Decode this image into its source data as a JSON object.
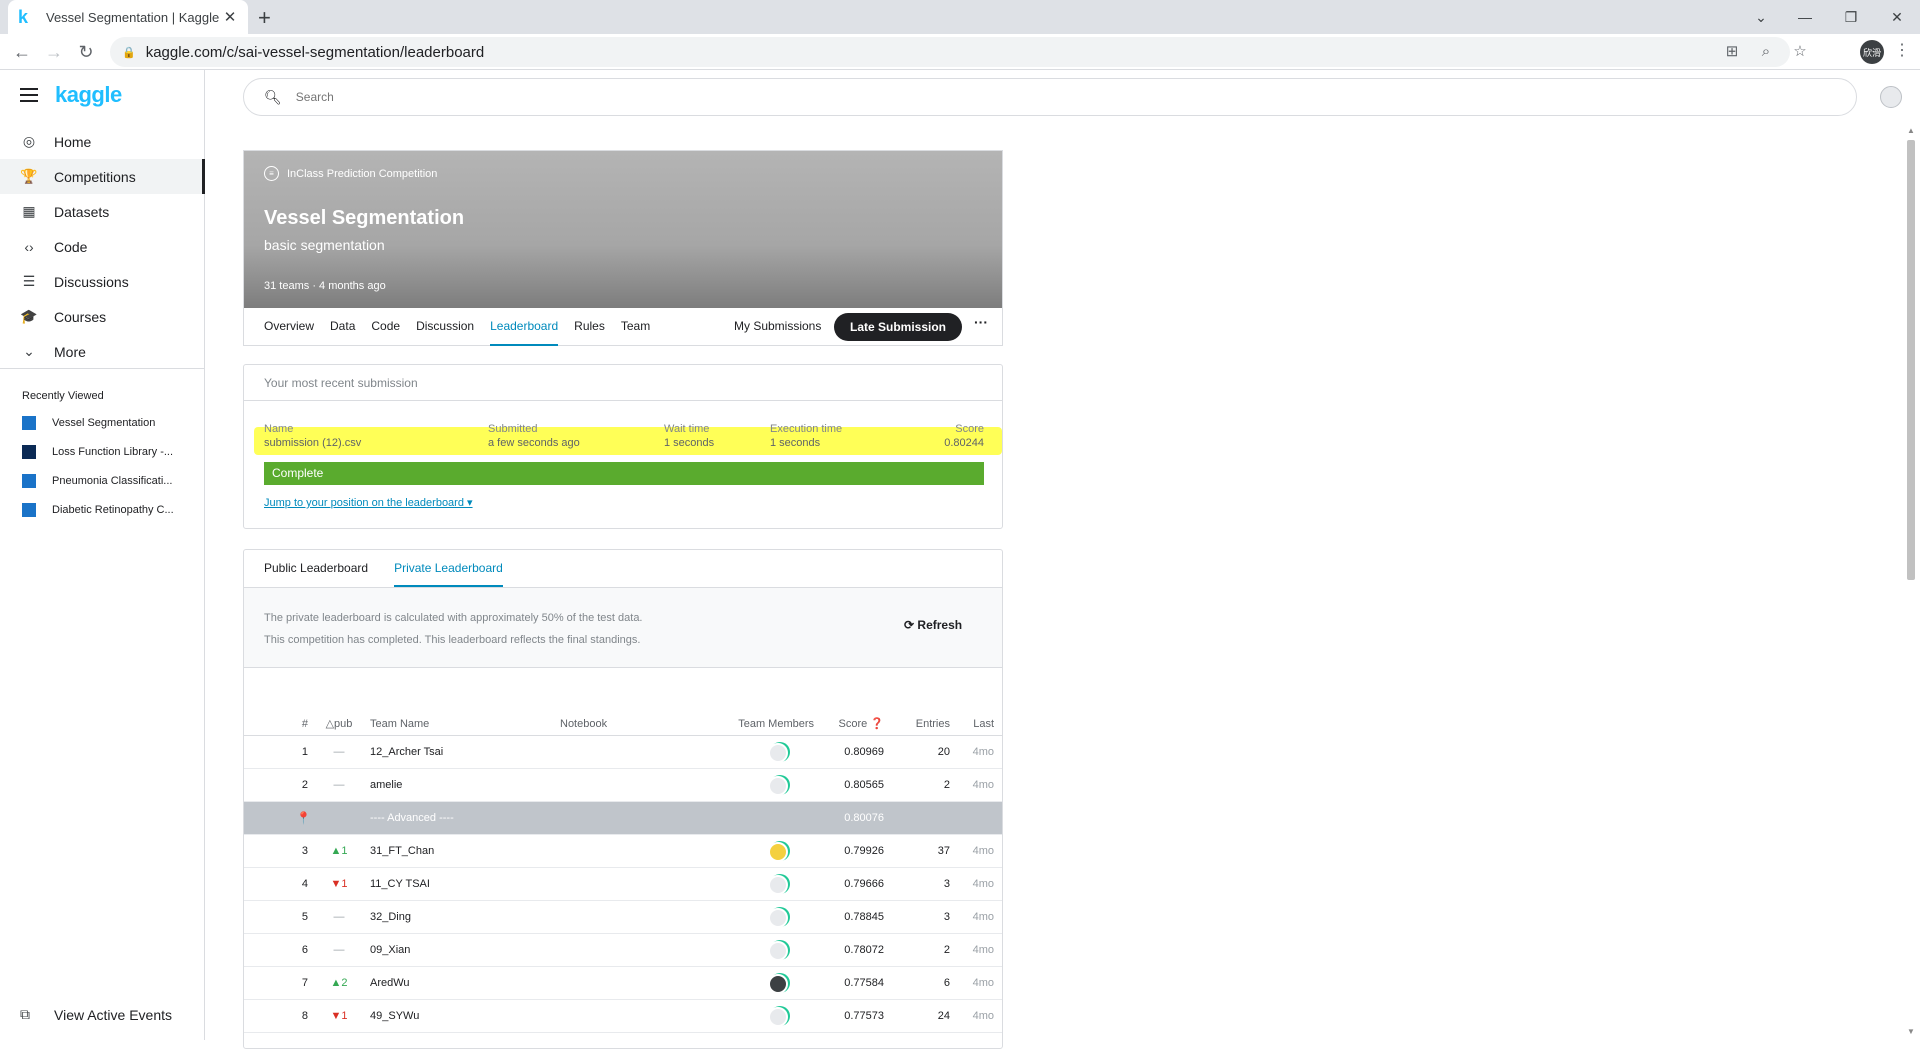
{
  "browser": {
    "tab_title": "Vessel Segmentation | Kaggle",
    "tab_favicon": "k",
    "url": "kaggle.com/c/sai-vessel-segmentation/leaderboard",
    "profile_initials": "欣滑"
  },
  "sidebar": {
    "logo": "kaggle",
    "items": [
      {
        "label": "Home",
        "icon": "compass-icon"
      },
      {
        "label": "Competitions",
        "icon": "trophy-icon"
      },
      {
        "label": "Datasets",
        "icon": "table-icon"
      },
      {
        "label": "Code",
        "icon": "code-icon"
      },
      {
        "label": "Discussions",
        "icon": "comments-icon"
      },
      {
        "label": "Courses",
        "icon": "school-icon"
      },
      {
        "label": "More",
        "icon": "chevron-down-icon"
      }
    ],
    "recently_viewed_title": "Recently Viewed",
    "recently_viewed": [
      {
        "label": "Vessel Segmentation"
      },
      {
        "label": "Loss Function Library -..."
      },
      {
        "label": "Pneumonia Classificati..."
      },
      {
        "label": "Diabetic Retinopathy C..."
      }
    ],
    "view_events": "View Active Events"
  },
  "search": {
    "placeholder": "Search"
  },
  "competition": {
    "type": "InClass Prediction Competition",
    "title": "Vessel Segmentation",
    "subtitle": "basic segmentation",
    "teams": "31 teams",
    "dot": "·",
    "age": "4 months ago",
    "tabs": [
      "Overview",
      "Data",
      "Code",
      "Discussion",
      "Leaderboard",
      "Rules",
      "Team"
    ],
    "my_submissions": "My Submissions",
    "late_submission": "Late Submission",
    "more": "···"
  },
  "submission": {
    "header": "Your most recent submission",
    "col_name": "Name",
    "col_submitted": "Submitted",
    "col_wait": "Wait time",
    "col_exec": "Execution time",
    "col_score": "Score",
    "name": "submission (12).csv",
    "submitted": "a few seconds ago",
    "wait": "1 seconds",
    "exec": "1 seconds",
    "score": "0.80244",
    "status": "Complete",
    "jump": "Jump to your position on the leaderboard ▾",
    "highlight_color": "#ffff3a"
  },
  "leaderboard": {
    "tabs": [
      "Public Leaderboard",
      "Private Leaderboard"
    ],
    "info1": "The private leaderboard is calculated with approximately 50% of the test data.",
    "info2": "This competition has completed. This leaderboard reflects the final standings.",
    "refresh": "Refresh",
    "headers": {
      "rank": "#",
      "delta": "△pub",
      "team": "Team Name",
      "notebook": "Notebook",
      "members": "Team Members",
      "score": "Score ❓",
      "entries": "Entries",
      "last": "Last"
    },
    "rows": [
      {
        "rank": "1",
        "delta": "—",
        "team": "12_Archer Tsai",
        "score": "0.80969",
        "entries": "20",
        "last": "4mo"
      },
      {
        "rank": "2",
        "delta": "—",
        "team": "amelie",
        "score": "0.80565",
        "entries": "2",
        "last": "4mo"
      },
      {
        "team": "---- Advanced ----",
        "score": "0.80076"
      },
      {
        "rank": "3",
        "delta": "▲1",
        "team": "31_FT_Chan",
        "score": "0.79926",
        "entries": "37",
        "last": "4mo"
      },
      {
        "rank": "4",
        "delta": "▼1",
        "team": "11_CY TSAI",
        "score": "0.79666",
        "entries": "3",
        "last": "4mo"
      },
      {
        "rank": "5",
        "delta": "—",
        "team": "32_Ding",
        "score": "0.78845",
        "entries": "3",
        "last": "4mo"
      },
      {
        "rank": "6",
        "delta": "—",
        "team": "09_Xian",
        "score": "0.78072",
        "entries": "2",
        "last": "4mo"
      },
      {
        "rank": "7",
        "delta": "▲2",
        "team": "AredWu",
        "score": "0.77584",
        "entries": "6",
        "last": "4mo"
      },
      {
        "rank": "8",
        "delta": "▼1",
        "team": "49_SYWu",
        "score": "0.77573",
        "entries": "24",
        "last": "4mo"
      }
    ]
  }
}
